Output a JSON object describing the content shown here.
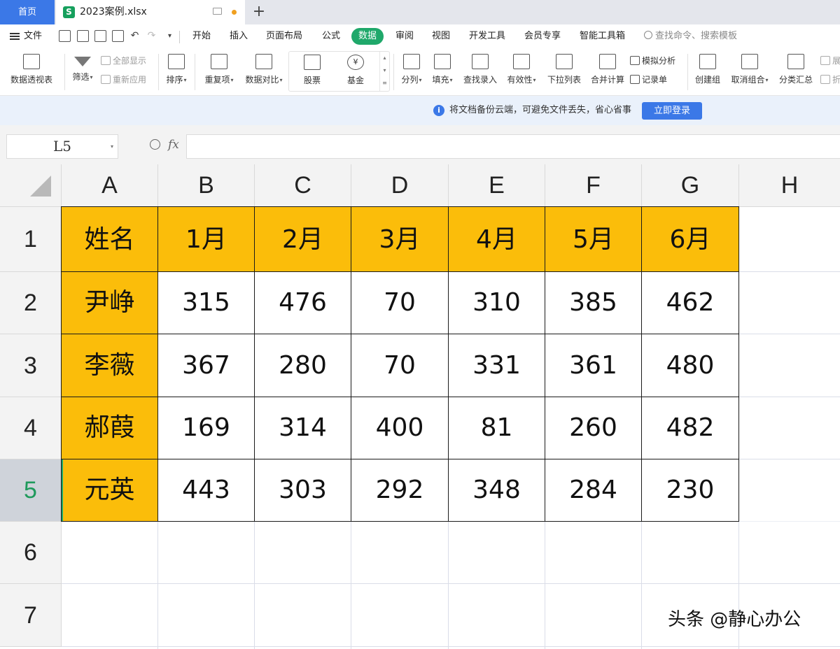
{
  "tabs": {
    "home": "首页",
    "file_name": "2023案例.xlsx",
    "new_tab": "+"
  },
  "menu": {
    "file": "文件",
    "items": [
      "开始",
      "插入",
      "页面布局",
      "公式",
      "数据",
      "审阅",
      "视图",
      "开发工具",
      "会员专享",
      "智能工具箱"
    ],
    "active": "数据",
    "search": "查找命令、搜索模板"
  },
  "ribbon": {
    "pivot": "数据透视表",
    "filter": "筛选",
    "show_all": "全部显示",
    "reapply": "重新应用",
    "sort": "排序",
    "duplicates": "重复项",
    "compare": "数据对比",
    "stock": "股票",
    "fund": "基金",
    "split": "分列",
    "fill": "填充",
    "lookup": "查找录入",
    "validity": "有效性",
    "dropdown": "下拉列表",
    "merge_calc": "合并计算",
    "simulate": "模拟分析",
    "record": "记录单",
    "group": "创建组",
    "ungroup": "取消组合",
    "subtotal": "分类汇总",
    "expand": "展",
    "collapse": "折"
  },
  "notice": {
    "text": "将文档备份云端，可避免文件丢失，省心省事",
    "login": "立即登录"
  },
  "formula_bar": {
    "name_box": "L5",
    "fx": "fx",
    "content": ""
  },
  "sheet": {
    "columns": [
      "A",
      "B",
      "C",
      "D",
      "E",
      "F",
      "G",
      "H"
    ],
    "rows": [
      "1",
      "2",
      "3",
      "4",
      "5",
      "6",
      "7"
    ],
    "selected_row": "5",
    "table": {
      "header": [
        "姓名",
        "1月",
        "2月",
        "3月",
        "4月",
        "5月",
        "6月"
      ],
      "body": [
        [
          "尹峥",
          "315",
          "476",
          "70",
          "310",
          "385",
          "462"
        ],
        [
          "李薇",
          "367",
          "280",
          "70",
          "331",
          "361",
          "480"
        ],
        [
          "郝葭",
          "169",
          "314",
          "400",
          "81",
          "260",
          "482"
        ],
        [
          "元英",
          "443",
          "303",
          "292",
          "348",
          "284",
          "230"
        ]
      ]
    }
  },
  "watermark": "头条 @静心办公",
  "colors": {
    "accent_green": "#1fa86a",
    "header_fill": "#fbbd0a",
    "tab_blue": "#3b78e7"
  }
}
